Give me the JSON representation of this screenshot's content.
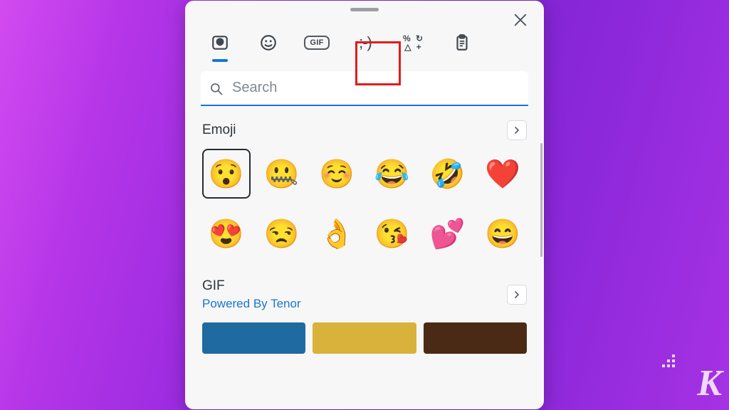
{
  "window": {
    "close_name": "close"
  },
  "tabs": {
    "recent": "Recent",
    "emoji": "Emoji",
    "gif_label": "GIF",
    "kaomoji": ";-)",
    "symbols_top": "% ↻",
    "symbols_bottom": "△ +",
    "clipboard": "Clipboard"
  },
  "search": {
    "placeholder": "Search"
  },
  "sections": {
    "emoji": {
      "title": "Emoji",
      "items": [
        "😯",
        "🤐",
        "☺️",
        "😂",
        "🤣",
        "❤️",
        "😍",
        "😒",
        "👌",
        "😘",
        "💕",
        "😄"
      ]
    },
    "gif": {
      "title": "GIF",
      "subtitle": "Powered By Tenor",
      "thumbs": [
        "#1f6aa0",
        "#d8b23a",
        "#4a2a15"
      ]
    }
  },
  "watermark": "K"
}
